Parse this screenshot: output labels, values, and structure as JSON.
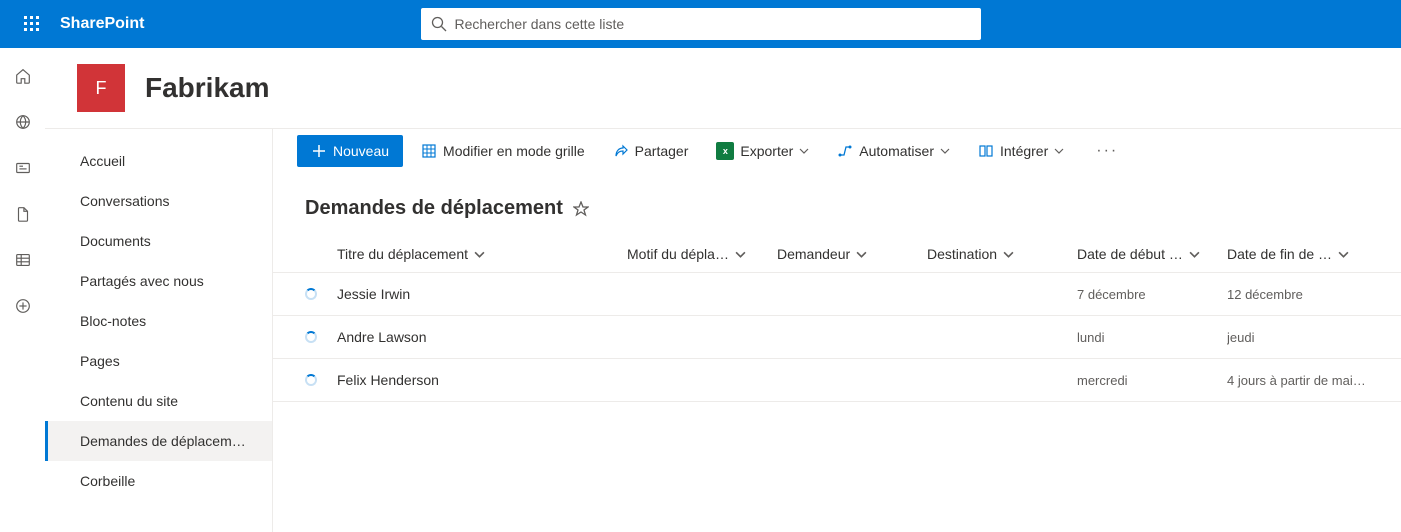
{
  "app_name": "SharePoint",
  "search": {
    "placeholder": "Rechercher dans cette liste"
  },
  "site": {
    "logo_letter": "F",
    "title": "Fabrikam"
  },
  "nav": {
    "items": [
      {
        "label": "Accueil"
      },
      {
        "label": "Conversations"
      },
      {
        "label": "Documents"
      },
      {
        "label": "Partagés avec nous"
      },
      {
        "label": "Bloc-notes"
      },
      {
        "label": "Pages"
      },
      {
        "label": "Contenu du site"
      },
      {
        "label": "Demandes de déplacem…",
        "active": true
      },
      {
        "label": "Corbeille"
      }
    ]
  },
  "cmd": {
    "new": "Nouveau",
    "edit_grid": "Modifier en mode grille",
    "share": "Partager",
    "export": "Exporter",
    "automate": "Automatiser",
    "integrate": "Intégrer"
  },
  "list": {
    "title": "Demandes de déplacement",
    "columns": {
      "title": "Titre du déplacement",
      "reason": "Motif du dépla…",
      "requester": "Demandeur",
      "destination": "Destination",
      "start_date": "Date de début …",
      "end_date": "Date de fin de …"
    },
    "rows": [
      {
        "title": "Jessie Irwin",
        "reason": "",
        "requester": "",
        "destination": "",
        "start_date": "7 décembre",
        "end_date": "12 décembre"
      },
      {
        "title": "Andre Lawson",
        "reason": "",
        "requester": "",
        "destination": "",
        "start_date": "lundi",
        "end_date": "jeudi"
      },
      {
        "title": "Felix Henderson",
        "reason": "",
        "requester": "",
        "destination": "",
        "start_date": "mercredi",
        "end_date": "4 jours à partir de mai…"
      }
    ]
  }
}
